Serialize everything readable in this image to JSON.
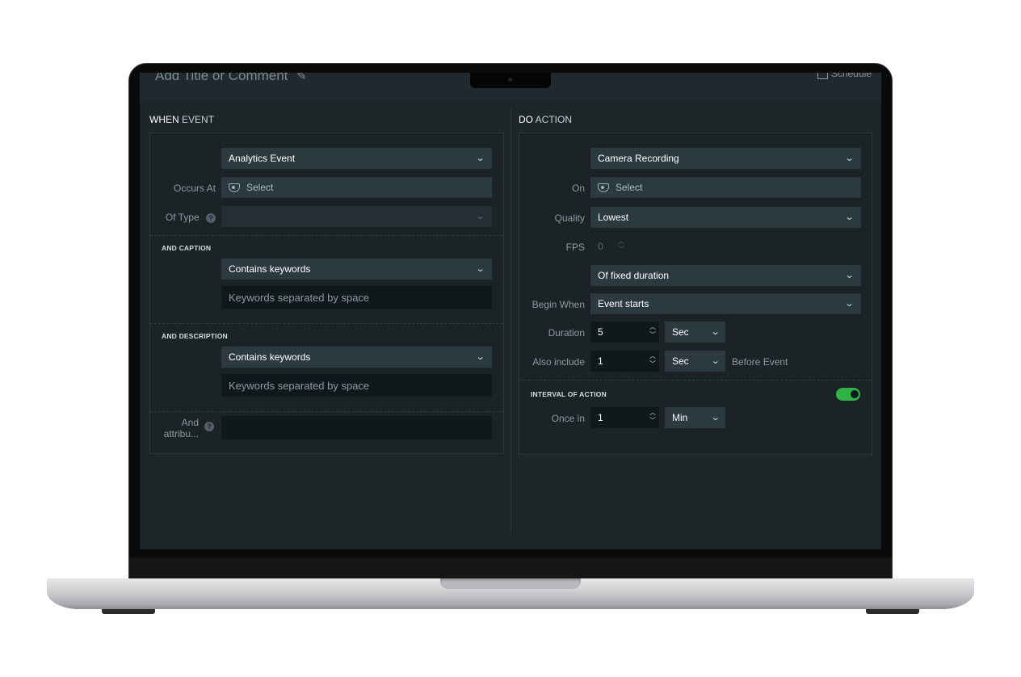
{
  "header": {
    "title_comment": "Add Title or Comment",
    "schedule_label": "Schedule"
  },
  "when": {
    "title_strong": "WHEN",
    "title_rest": "EVENT",
    "event_type": "Analytics Event",
    "occurs_at_label": "Occurs At",
    "occurs_at_value": "Select",
    "of_type_label": "Of Type",
    "of_type_value": "",
    "caption_section": "AND CAPTION",
    "caption_match": "Contains keywords",
    "caption_placeholder": "Keywords separated by space",
    "description_section": "AND DESCRIPTION",
    "description_match": "Contains keywords",
    "description_placeholder": "Keywords separated by space",
    "attribute_label_line1": "And",
    "attribute_label_line2": "attribu..."
  },
  "do": {
    "title_strong": "DO",
    "title_rest": "ACTION",
    "action_type": "Camera Recording",
    "on_label": "On",
    "on_value": "Select",
    "quality_label": "Quality",
    "quality_value": "Lowest",
    "fps_label": "FPS",
    "fps_value": "0",
    "duration_mode": "Of fixed duration",
    "begin_when_label": "Begin When",
    "begin_when_value": "Event starts",
    "duration_label": "Duration",
    "duration_value": "5",
    "duration_unit": "Sec",
    "also_include_label": "Also include",
    "also_include_value": "1",
    "also_include_unit": "Sec",
    "before_event_label": "Before Event",
    "interval_section": "INTERVAL OF ACTION",
    "interval_enabled": true,
    "once_in_label": "Once in",
    "once_in_value": "1",
    "once_in_unit": "Min"
  },
  "colors": {
    "background": "#1d2529",
    "field": "#2c3940",
    "toggle_on": "#2fb344"
  },
  "icons": {
    "camera": "camera-icon",
    "chevron": "chevron-down-icon",
    "help": "help-icon",
    "pencil": "pencil-icon"
  }
}
